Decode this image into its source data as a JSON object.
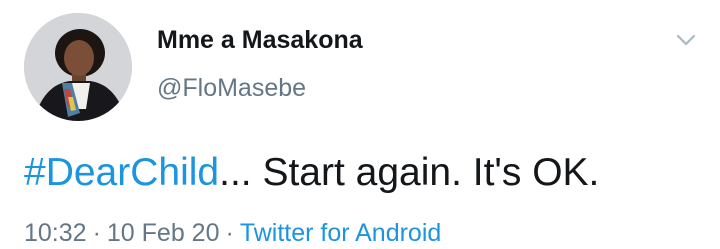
{
  "author": {
    "display_name": "Mme a Masakona",
    "handle": "@FloMasebe"
  },
  "tweet": {
    "hashtag": "#DearChild",
    "text": "... Start again. It's OK."
  },
  "meta": {
    "time": "10:32",
    "separator": "·",
    "date": "10 Feb 20",
    "source": "Twitter for Android"
  },
  "icons": {
    "menu": "chevron-down-icon"
  },
  "colors": {
    "link": "#1b95e0",
    "text": "#14171a",
    "secondary": "#657786",
    "chevron": "#aab8c2"
  }
}
